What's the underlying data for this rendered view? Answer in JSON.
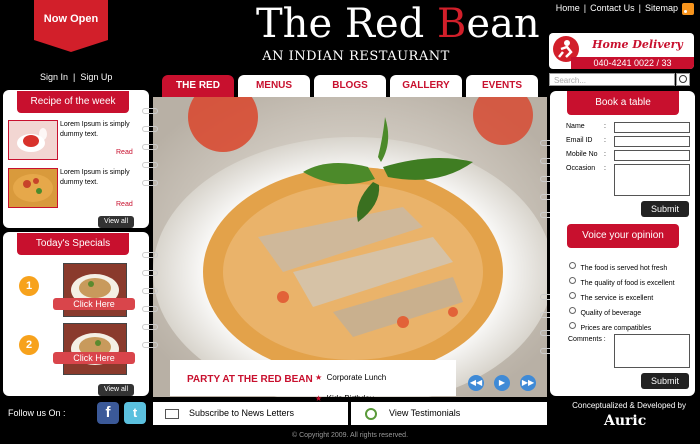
{
  "header": {
    "now_open": "Now Open",
    "logo_start": "The Red ",
    "logo_b": "B",
    "logo_end": "ean",
    "tagline": "AN INDIAN RESTAURANT",
    "links": [
      "Home",
      "Contact Us",
      "Sitemap"
    ],
    "sign_in": "Sign In",
    "sign_up": "Sign Up",
    "delivery_title": "Home Delivery",
    "delivery_phone": "040-4241 0022 / 33",
    "search_placeholder": "Search..."
  },
  "nav": {
    "tabs": [
      "THE RED BEAN",
      "MENUS",
      "BLOGS",
      "GALLERY",
      "EVENTS"
    ]
  },
  "recipe": {
    "title": "Recipe of the week",
    "items": [
      {
        "text": "Lorem Ipsum is simply dummy text.",
        "read": "Read"
      },
      {
        "text": "Lorem Ipsum is simply dummy text.",
        "read": "Read"
      }
    ],
    "view_all": "View all"
  },
  "specials": {
    "title": "Today's Specials",
    "items": [
      {
        "num": "1",
        "label": "Click Here"
      },
      {
        "num": "2",
        "label": "Click Here"
      }
    ],
    "view_all": "View all"
  },
  "hero": {
    "caption_title": "PARTY AT THE RED BEAN",
    "caption_items": [
      "Corporate Lunch",
      "Kids Birthday"
    ]
  },
  "book": {
    "title": "Book a table",
    "fields": [
      "Name",
      "Email ID",
      "Mobile No",
      "Occasion"
    ],
    "submit": "Submit"
  },
  "opinion": {
    "title": "Voice your opinion",
    "options": [
      "The food is served hot fresh",
      "The quality of food is excellent",
      "The service is excellent",
      "Quality of beverage",
      "Prices are compatibles"
    ],
    "comments_label": "Comments",
    "submit": "Submit"
  },
  "footer": {
    "follow": "Follow us On :",
    "subscribe": "Subscribe to News Letters",
    "testimonials": "View Testimonials",
    "developed": "Conceptualized & Developed by",
    "company": "Auric",
    "copyright": "© Copyright 2009. All rights reserved."
  },
  "colors": {
    "brand_red": "#c8102e",
    "accent_orange": "#f7a21c",
    "nav_arrow_blue": "#3f8ad6"
  }
}
